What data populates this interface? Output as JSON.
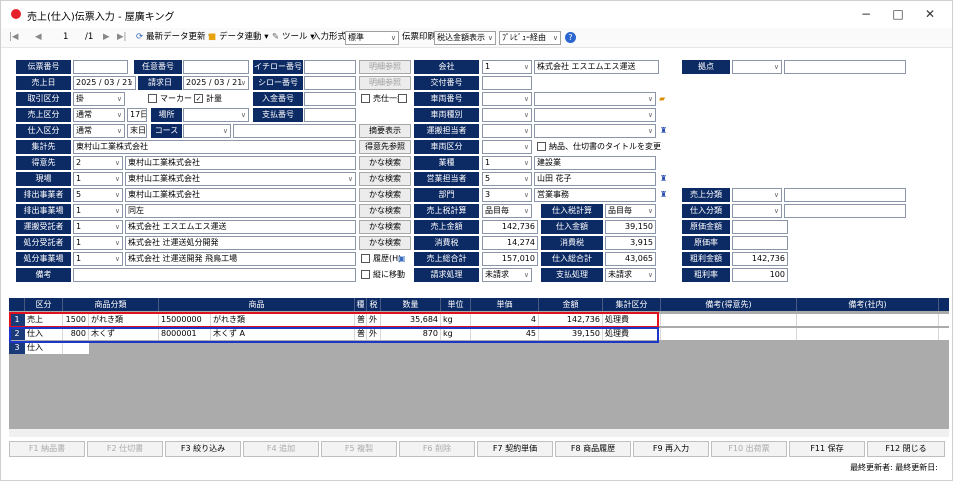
{
  "window": {
    "title": "売上(仕入)伝票入力 - 屋廣キング",
    "min": "−",
    "max": "□",
    "close": "✕"
  },
  "toolbar": {
    "first": "|◀",
    "prev": "◀",
    "page": "1",
    "sep": "/1",
    "next": "▶",
    "last": "▶|",
    "refresh": "最新データ更新 ▾",
    "link": "データ連動 ▾",
    "tools": "ツール ▾",
    "input_format_label": "入力形式",
    "input_format": "標準",
    "print_label": "伝票印刷",
    "tax_display": "税込金額表示",
    "preview": "ﾌﾟﾚﾋﾞｭｰ経由",
    "help": "?"
  },
  "form": {
    "slip_no": "伝票番号",
    "any_no": "任意番号",
    "ichiro_no": "イチロー番号",
    "ref_btn1": "明細参照",
    "company": "会社",
    "company_code": "1",
    "company_name": "株式会社 エスエムエス運送",
    "base": "拠点",
    "sales_date": "売上日",
    "sales_date_val": "2025 / 03 / 21",
    "claim_date": "請求日",
    "claim_date_val": "2025 / 03 / 21",
    "shiro_no": "シロー番号",
    "ref_btn2": "明細参照",
    "issue_no": "交付番号",
    "trade_type": "取引区分",
    "trade_val": "掛",
    "marker": "マーカー",
    "weighing": "計量",
    "deposit_no": "入金番号",
    "sales_batch": "売仕一括",
    "vehicle_no": "車両番号",
    "sales_type": "売上区分",
    "sales_type_val": "通常",
    "close17": "17日",
    "place": "場所",
    "pay_no": "支払番号",
    "vehicle_kind": "車両種別",
    "purchase_type": "仕入区分",
    "purchase_type_val": "通常",
    "close_end": "末日",
    "course": "コース",
    "summary_btn": "摘要表示",
    "driver": "運搬担当者",
    "note_check": "納品、仕切書のタイトルを変更",
    "collect": "集計先",
    "collect_val": "東村山工業株式会社",
    "customer_ref_btn": "得意先参照",
    "vehicle_class": "車両区分",
    "customer": "得意先",
    "customer_code": "2",
    "customer_name": "東村山工業株式会社",
    "kana1": "かな検索",
    "industry": "業種",
    "industry_code": "1",
    "industry_name": "建設業",
    "site": "現場",
    "site_code": "1",
    "site_name": "東村山工業株式会社",
    "kana2": "かな検索",
    "sales_person": "営業担当者",
    "sales_person_code": "5",
    "sales_person_name": "山田 花子",
    "emitter": "排出事業者",
    "emitter_code": "5",
    "emitter_name": "東村山工業株式会社",
    "kana3": "かな検索",
    "dept": "部門",
    "dept_code": "3",
    "dept_name": "営業事務",
    "sales_class1": "売上分類",
    "emit_site": "排出事業場",
    "emit_site_code": "1",
    "emit_site_name": "同左",
    "kana4": "かな検索",
    "sales_tax_calc": "売上税計算",
    "sales_tax_calc_val": "品目毎",
    "purchase_tax_calc": "仕入税計算",
    "purchase_tax_calc_val": "品目毎",
    "purchase_class": "仕入分類",
    "transport": "運搬受託者",
    "transport_code": "1",
    "transport_name": "株式会社 エスエムエス運送",
    "kana5": "かな検索",
    "sales_amount": "売上金額",
    "sales_amount_val": "142,736",
    "purchase_amount": "仕入金額",
    "purchase_amount_val": "39,150",
    "cost_amount": "原価金額",
    "disposal": "処分受託者",
    "disposal_code": "1",
    "disposal_name": "株式会社 辻運送処分開発",
    "kana6": "かな検索",
    "consumption_tax": "消費税",
    "consumption_tax_val": "14,274",
    "consumption_tax2": "消費税",
    "consumption_tax2_val": "3,915",
    "cost_rate": "原価率",
    "disposal_site": "処分事業場",
    "disposal_site_code": "1",
    "disposal_site_name": "株式会社 辻運送開発 飛鳥工場",
    "history": "履歴(H)",
    "sales_total": "売上総合計",
    "sales_total_val": "157,010",
    "purchase_total": "仕入総合計",
    "purchase_total_val": "43,065",
    "gross_amount": "粗利金額",
    "gross_amount_val": "142,736",
    "remarks": "備考",
    "vertical_move": "縦に移動",
    "claim_proc": "請求処理",
    "claim_proc_val": "未請求",
    "pay_proc": "支払処理",
    "pay_proc_val": "未請求",
    "gross_rate": "粗利率",
    "gross_rate_val": "100"
  },
  "grid": {
    "headers": [
      "区分",
      "商品分類",
      "商品",
      "種",
      "税",
      "数量",
      "単位",
      "単価",
      "金額",
      "集計区分",
      "備考(得意先)",
      "備考(社内)"
    ],
    "rows": [
      {
        "num": "1",
        "kubun": "売上",
        "cat_code": "1500",
        "cat": "がれき類",
        "prod_code": "15000000",
        "prod": "がれき類",
        "kind": "普",
        "tax": "外",
        "qty": "35,684",
        "unit": "kg",
        "price": "4",
        "amount": "142,736",
        "agg": "処理費"
      },
      {
        "num": "2",
        "kubun": "仕入",
        "cat_code": "800",
        "cat": "木くず",
        "prod_code": "8000001",
        "prod": "木くず A",
        "kind": "普",
        "tax": "外",
        "qty": "870",
        "unit": "kg",
        "price": "45",
        "amount": "39,150",
        "agg": "処理費"
      },
      {
        "num": "3",
        "kubun": "仕入"
      }
    ]
  },
  "fkeys": [
    "F1 納品書",
    "F2 仕切書",
    "F3 絞り込み",
    "F4 追加",
    "F5 複製",
    "F6 削除",
    "F7 契約単価",
    "F8 商品履歴",
    "F9 再入力",
    "F10 出荷票",
    "F11 保存",
    "F12 閉じる"
  ],
  "status": "最終更新者: 最終更新日:"
}
